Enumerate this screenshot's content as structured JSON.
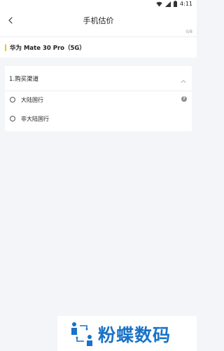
{
  "status_bar": {
    "time": "4:11"
  },
  "header": {
    "title": "手机估价"
  },
  "progress": {
    "text": "0/8",
    "current": 0,
    "total": 8
  },
  "model": {
    "name": "华为 Mate 30 Pro（5G）"
  },
  "question": {
    "title": "1.购买渠道",
    "options": [
      {
        "label": "大陆国行"
      },
      {
        "label": "非大陆国行"
      }
    ],
    "help_symbol": "?"
  },
  "watermark": {
    "text": "粉蝶数码"
  },
  "colors": {
    "accent": "#f4c400",
    "brand_blue": "#1a73c7",
    "background": "#f3f5f8"
  }
}
